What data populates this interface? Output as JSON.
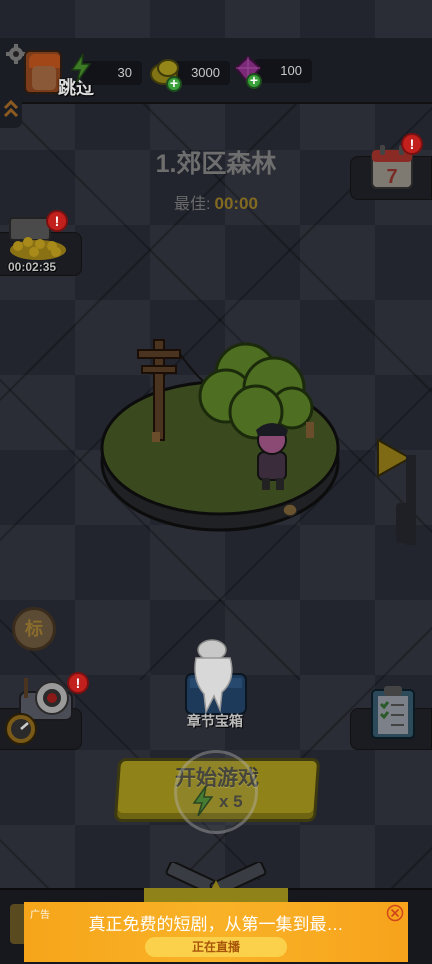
{
  "header": {
    "skip_label": "跳过",
    "energy_value": "30",
    "coins_value": "3000",
    "gems_value": "100"
  },
  "stage": {
    "title": "1.郊区森林",
    "best_label": "最佳:",
    "best_time": "00:00"
  },
  "side_buttons": {
    "calendar_day": "7",
    "calendar_badge": "!",
    "chest_badge": "!",
    "chest_timer": "00:02:35",
    "tag_label": "标",
    "robot_badge": "!"
  },
  "actions": {
    "chapter_chest_label": "章节宝箱",
    "start_label": "开始游戏",
    "start_cost": "x 5"
  },
  "ad": {
    "tag": "广告",
    "text": "真正免费的短剧，从第一集到最…",
    "cta": "正在直播"
  },
  "colors": {
    "accent_yellow": "#f9b227",
    "badge_red": "#c2201c",
    "plus_green": "#3aa13a"
  }
}
